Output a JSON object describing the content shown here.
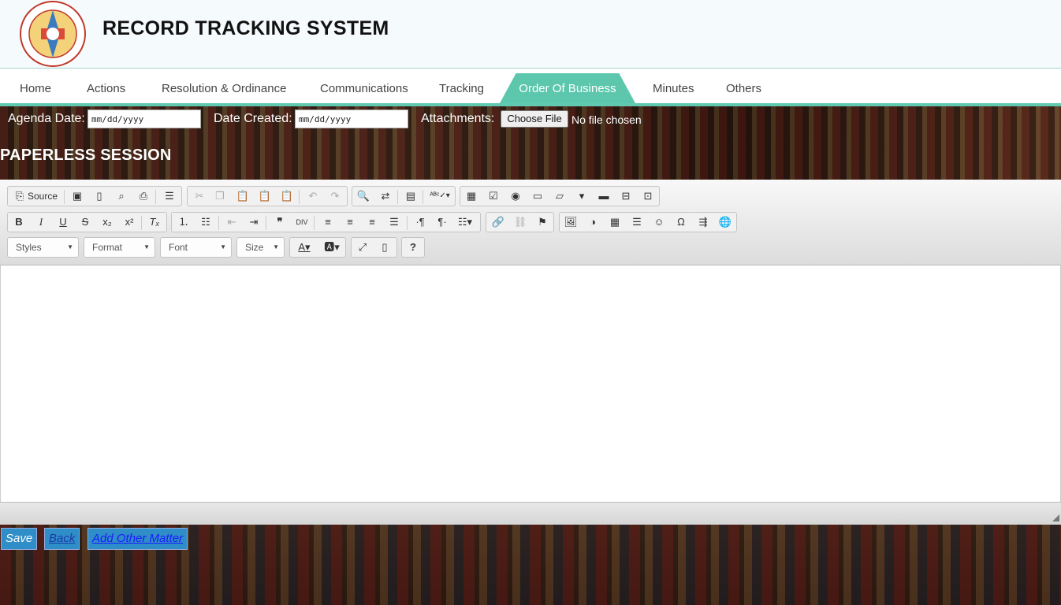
{
  "header": {
    "title": "RECORD TRACKING SYSTEM",
    "logo_icon": "municipal-seal-icon"
  },
  "nav": {
    "items": [
      "Home",
      "Actions",
      "Resolution & Ordinance",
      "Communications",
      "Tracking",
      "Order Of Business",
      "Minutes",
      "Others"
    ],
    "active": "Order Of Business",
    "accent": "#5cc7ad"
  },
  "form": {
    "agenda_label": "Agenda Date:",
    "agenda_placeholder": "mm/dd/yyyy",
    "created_label": "Date Created:",
    "created_placeholder": "mm/dd/yyyy",
    "attach_label": "Attachments:",
    "choose_file": "Choose File",
    "file_status": "No file chosen"
  },
  "section_title": "PAPERLESS SESSION",
  "editor": {
    "source_label": "Source",
    "combos": [
      "Styles",
      "Format",
      "Font",
      "Size"
    ]
  },
  "actions": {
    "save": "Save",
    "back": "Back",
    "add_other": "Add Other Matter"
  }
}
